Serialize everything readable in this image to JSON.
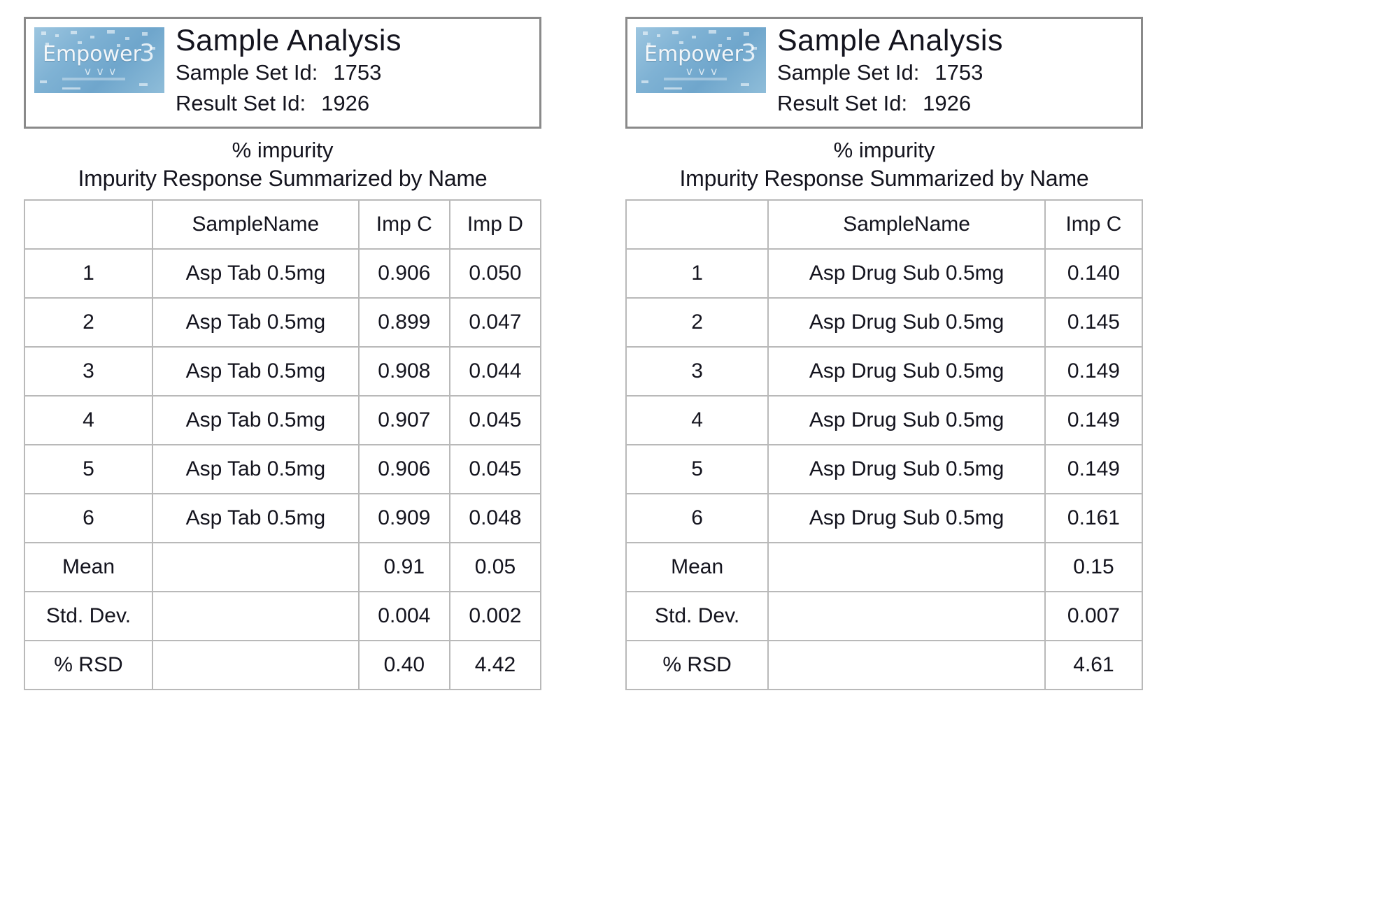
{
  "reports": [
    {
      "id": "left",
      "logo": {
        "brand": "Empower",
        "number": "3",
        "sub": "v v v"
      },
      "header": {
        "title": "Sample Analysis",
        "sample_set_label": "Sample Set Id:",
        "sample_set_value": "1753",
        "result_set_label": "Result Set Id:",
        "result_set_value": "1926"
      },
      "subtitle_1": "% impurity",
      "subtitle_2": "Impurity Response Summarized by Name",
      "table": {
        "columns": [
          "",
          "SampleName",
          "Imp C",
          "Imp D"
        ],
        "rows": [
          [
            "1",
            "Asp Tab 0.5mg",
            "0.906",
            "0.050"
          ],
          [
            "2",
            "Asp Tab 0.5mg",
            "0.899",
            "0.047"
          ],
          [
            "3",
            "Asp Tab 0.5mg",
            "0.908",
            "0.044"
          ],
          [
            "4",
            "Asp Tab 0.5mg",
            "0.907",
            "0.045"
          ],
          [
            "5",
            "Asp Tab 0.5mg",
            "0.906",
            "0.045"
          ],
          [
            "6",
            "Asp Tab 0.5mg",
            "0.909",
            "0.048"
          ]
        ],
        "stats": [
          [
            "Mean",
            "",
            "0.91",
            "0.05"
          ],
          [
            "Std. Dev.",
            "",
            "0.004",
            "0.002"
          ],
          [
            "% RSD",
            "",
            "0.40",
            "4.42"
          ]
        ]
      }
    },
    {
      "id": "right",
      "logo": {
        "brand": "Empower",
        "number": "3",
        "sub": "v v v"
      },
      "header": {
        "title": "Sample Analysis",
        "sample_set_label": "Sample Set Id:",
        "sample_set_value": "1753",
        "result_set_label": "Result Set Id:",
        "result_set_value": "1926"
      },
      "subtitle_1": "% impurity",
      "subtitle_2": "Impurity Response Summarized by Name",
      "table": {
        "columns": [
          "",
          "SampleName",
          "Imp C"
        ],
        "rows": [
          [
            "1",
            "Asp Drug Sub 0.5mg",
            "0.140"
          ],
          [
            "2",
            "Asp Drug Sub 0.5mg",
            "0.145"
          ],
          [
            "3",
            "Asp Drug Sub 0.5mg",
            "0.149"
          ],
          [
            "4",
            "Asp Drug Sub 0.5mg",
            "0.149"
          ],
          [
            "5",
            "Asp Drug Sub 0.5mg",
            "0.149"
          ],
          [
            "6",
            "Asp Drug Sub 0.5mg",
            "0.161"
          ]
        ],
        "stats": [
          [
            "Mean",
            "",
            "0.15"
          ],
          [
            "Std. Dev.",
            "",
            "0.007"
          ],
          [
            "% RSD",
            "",
            "4.61"
          ]
        ]
      }
    }
  ],
  "colors": {
    "logo_blue": "#7fb2d4",
    "border_gray": "#b9b9b9",
    "banner_border": "#8a8a8a",
    "text": "#14141e"
  }
}
